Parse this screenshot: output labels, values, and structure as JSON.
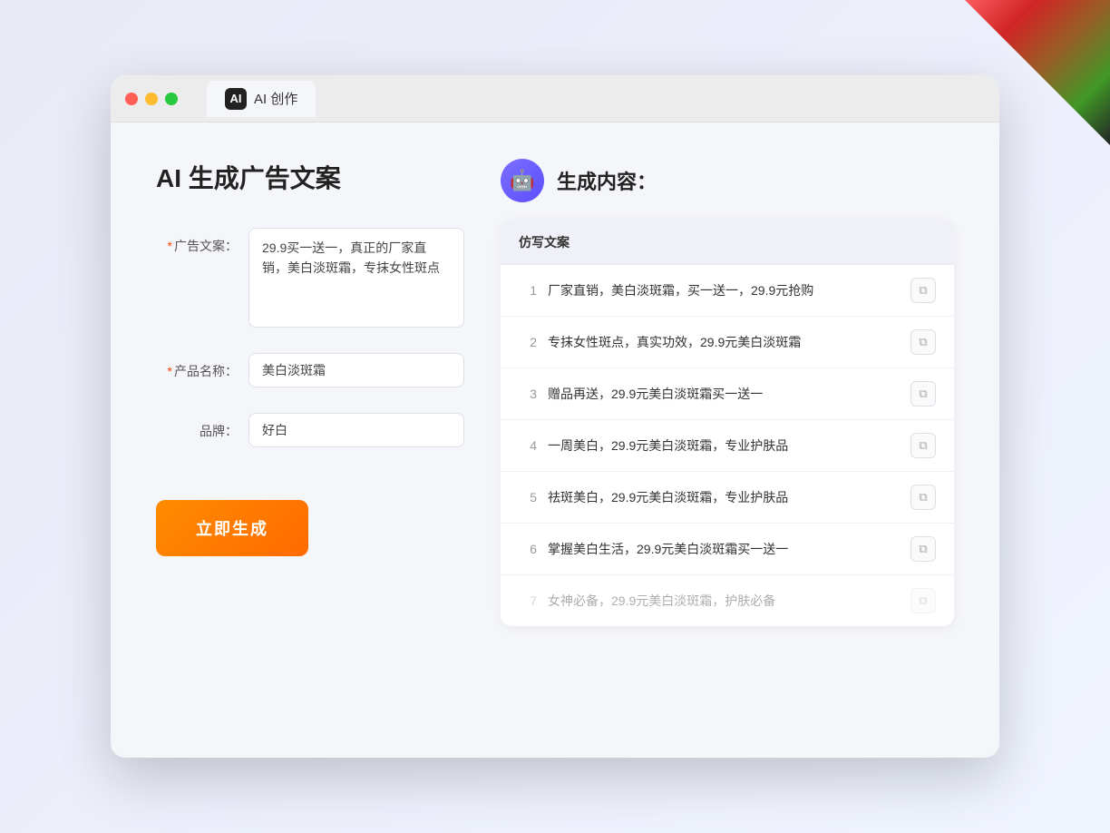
{
  "window": {
    "tab_icon": "AI",
    "tab_label": "AI 创作"
  },
  "left": {
    "page_title": "AI 生成广告文案",
    "fields": [
      {
        "id": "ad_copy",
        "label": "广告文案：",
        "required": true,
        "type": "textarea",
        "value": "29.9买一送一，真正的厂家直销，美白淡斑霜，专抹女性斑点"
      },
      {
        "id": "product_name",
        "label": "产品名称：",
        "required": true,
        "type": "text",
        "value": "美白淡斑霜"
      },
      {
        "id": "brand",
        "label": "品牌：",
        "required": false,
        "type": "text",
        "value": "好白"
      }
    ],
    "generate_btn": "立即生成"
  },
  "right": {
    "title": "生成内容：",
    "table_header": "仿写文案",
    "results": [
      {
        "num": "1",
        "text": "厂家直销，美白淡斑霜，买一送一，29.9元抢购"
      },
      {
        "num": "2",
        "text": "专抹女性斑点，真实功效，29.9元美白淡斑霜"
      },
      {
        "num": "3",
        "text": "赠品再送，29.9元美白淡斑霜买一送一"
      },
      {
        "num": "4",
        "text": "一周美白，29.9元美白淡斑霜，专业护肤品"
      },
      {
        "num": "5",
        "text": "祛斑美白，29.9元美白淡斑霜，专业护肤品"
      },
      {
        "num": "6",
        "text": "掌握美白生活，29.9元美白淡斑霜买一送一"
      },
      {
        "num": "7",
        "text": "女神必备，29.9元美白淡斑霜，护肤必备",
        "dimmed": true
      }
    ]
  }
}
